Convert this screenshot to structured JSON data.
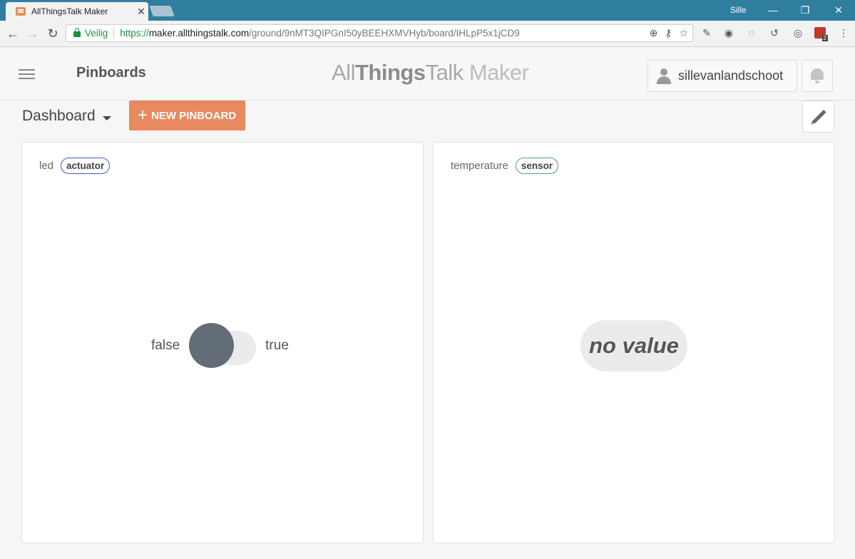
{
  "browser": {
    "tab_title": "AllThingsTalk Maker",
    "tab_close": "✕",
    "window_user": "Sille",
    "window_buttons": {
      "minimize": "—",
      "restore": "❐",
      "close": "✕"
    },
    "nav": {
      "back": "←",
      "forward": "→",
      "reload": "↻"
    },
    "security_label": "Veilig",
    "url_scheme": "https://",
    "url_host": "maker.allthingstalk.com",
    "url_path": "/ground/9nMT3QIPGnI50yBEEHXMVHyb/board/IHLpP5x1jCD9",
    "omnibox_icons": {
      "zoom": "⊕",
      "key": "⚷",
      "star": "☆"
    },
    "extension_badge_count": "2",
    "menu": "⋮"
  },
  "header": {
    "page_title": "Pinboards",
    "brand_all": "All",
    "brand_things": "Things",
    "brand_talk": "Talk",
    "brand_maker": "Maker",
    "username": "sillevanlandschoot"
  },
  "dashboard": {
    "selector_label": "Dashboard",
    "new_pinboard_plus": "+",
    "new_pinboard_label": "NEW PINBOARD"
  },
  "cards": [
    {
      "asset_name": "led",
      "kind": "actuator",
      "kind_color": "#3e59c7",
      "false_label": "false",
      "true_label": "true",
      "state": false
    },
    {
      "asset_name": "temperature",
      "kind": "sensor",
      "kind_color": "#4aa86b",
      "value_text": "no value"
    }
  ],
  "colors": {
    "accent": "#e8895f",
    "titlebar": "#2f7ea0",
    "toggle_knob": "#636d78"
  }
}
